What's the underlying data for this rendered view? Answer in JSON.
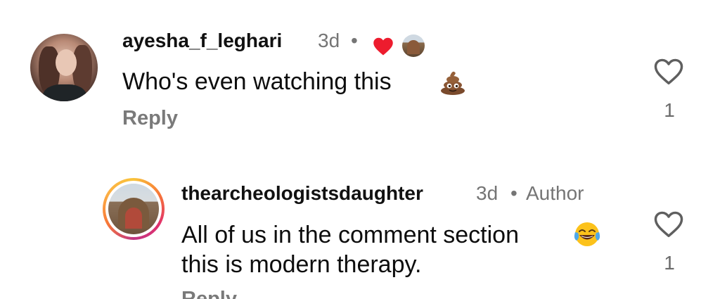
{
  "comments": [
    {
      "username": "ayesha_f_leghari",
      "time": "3d",
      "separator": "•",
      "text": "Who's even watching this",
      "emoji_icon": "poop-emoji-icon",
      "reply_label": "Reply",
      "like_count": "1",
      "creator_liked": true
    },
    {
      "username": "thearcheologistsdaughter",
      "time": "3d",
      "separator": "•",
      "badge": "Author",
      "text_line1": "All of us in the comment section",
      "text_line2": "this is modern therapy.",
      "emoji_icon": "tears-of-joy-emoji-icon",
      "reply_label": "Reply",
      "like_count": "1"
    }
  ],
  "colors": {
    "like_red": "#ed1c2e",
    "meta_gray": "#757575",
    "reply_gray": "#7a7a7a"
  }
}
